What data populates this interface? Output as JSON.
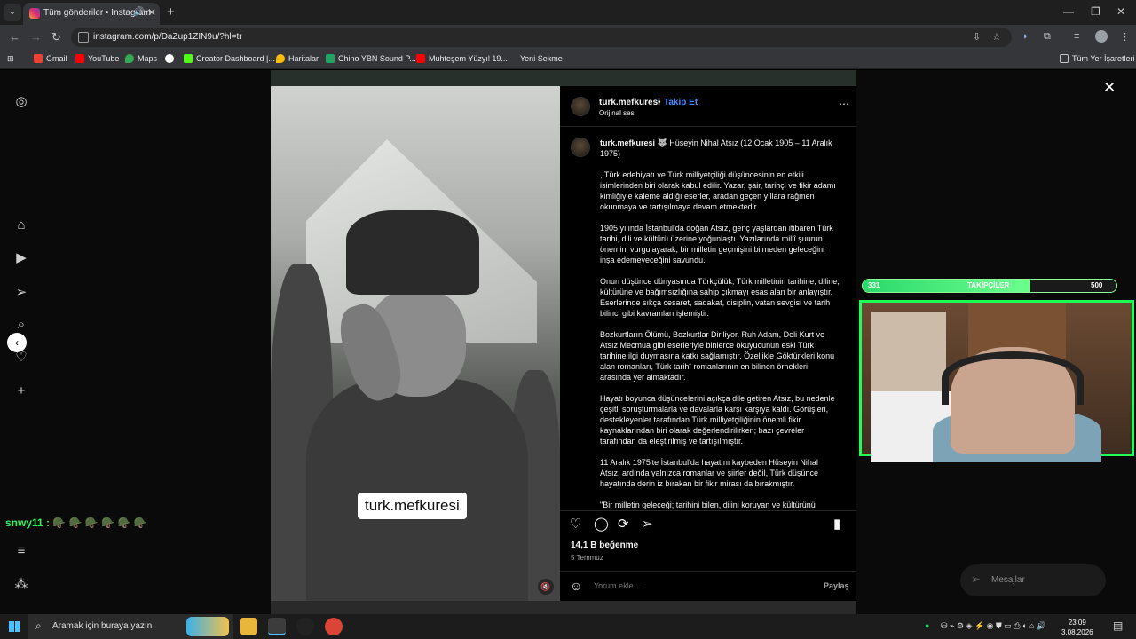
{
  "browser": {
    "tab": {
      "title": "Tüm gönderiler • Instagram"
    },
    "url": "instagram.com/p/DaZup1ZIN9u/?hl=tr",
    "bookmarks": [
      "Gmail",
      "YouTube",
      "Maps",
      "Creator Dashboard |...",
      "Haritalar",
      "Chino YBN Sound P...",
      "Muhteşem Yüzyıl 19...",
      "Yeni Sekme"
    ],
    "all_bookmarks": "Tüm Yer İşaretleri"
  },
  "post": {
    "username": "turk.mefkuresi",
    "follow": "Takip Et",
    "audio": "Orijinal ses",
    "media_label": "turk.mefkuresi",
    "caption": {
      "user": "turk.mefkuresi",
      "head": " 🐺 Hüseyin Nihal Atsız (12 Ocak 1905 – 11 Aralık 1975)",
      "p1": ", Türk edebiyatı ve Türk milliyetçiliği düşüncesinin en etkili isimlerinden biri olarak kabul edilir. Yazar, şair, tarihçi ve fikir adamı kimliğiyle kaleme aldığı eserler, aradan geçen yıllara rağmen okunmaya ve tartışılmaya devam etmektedir.",
      "p2": "1905 yılında İstanbul'da doğan Atsız, genç yaşlardan itibaren Türk tarihi, dili ve kültürü üzerine yoğunlaştı. Yazılarında millî şuurun önemini vurgulayarak, bir milletin geçmişini bilmeden geleceğini inşa edemeyeceğini savundu.",
      "p3": "Onun düşünce dünyasında Türkçülük; Türk milletinin tarihine, diline, kültürüne ve bağımsızlığına sahip çıkmayı esas alan bir anlayıştır. Eserlerinde sıkça cesaret, sadakat, disiplin, vatan sevgisi ve tarih bilinci gibi kavramları işlemiştir.",
      "p4": "Bozkurtların Ölümü, Bozkurtlar Diriliyor, Ruh Adam, Deli Kurt ve Atsız Mecmua gibi eserleriyle binlerce okuyucunun eski Türk tarihine ilgi duymasına katkı sağlamıştır. Özellikle Göktürkleri konu alan romanları, Türk tarihî romanlarının en bilinen örnekleri arasında yer almaktadır.",
      "p5": "Hayatı boyunca düşüncelerini açıkça dile getiren Atsız, bu nedenle çeşitli soruşturmalarla ve davalarla karşı karşıya kaldı. Görüşleri, destekleyenler tarafından Türk milliyetçiliğinin önemli fikir kaynaklarından biri olarak değerlendirilirken; bazı çevreler tarafından da eleştirilmiş ve tartışılmıştır.",
      "p6": "11 Aralık 1975'te İstanbul'da hayatını kaybeden Hüseyin Nihal Atsız, ardında yalnızca romanlar ve şiirler değil, Türk düşünce hayatında derin iz bırakan bir fikir mirası da bırakmıştır.",
      "p7": "\"Bir milletin geleceği; tarihini bilen, dilini koruyan ve kültürünü"
    },
    "likes": "14,1 B beğenme",
    "date": "5 Temmuz",
    "comment_placeholder": "Yorum ekle...",
    "share": "Paylaş"
  },
  "overlay": {
    "chat_user": "snwy11 :",
    "chat_emojis": "🪖 🪖 🪖 🪖 🪖 🪖",
    "followers": {
      "current": "331",
      "label": "TAKİPÇİLER",
      "goal": "500",
      "progress": 0.662
    },
    "messages": "Mesajlar"
  },
  "taskbar": {
    "search": "Aramak için buraya yazın",
    "time": "23:09",
    "date": "3.08.2026"
  },
  "colors": {
    "accent_follow": "#4a8cff",
    "stream_green": "#1eff55",
    "chat_green": "#2cf15a"
  }
}
